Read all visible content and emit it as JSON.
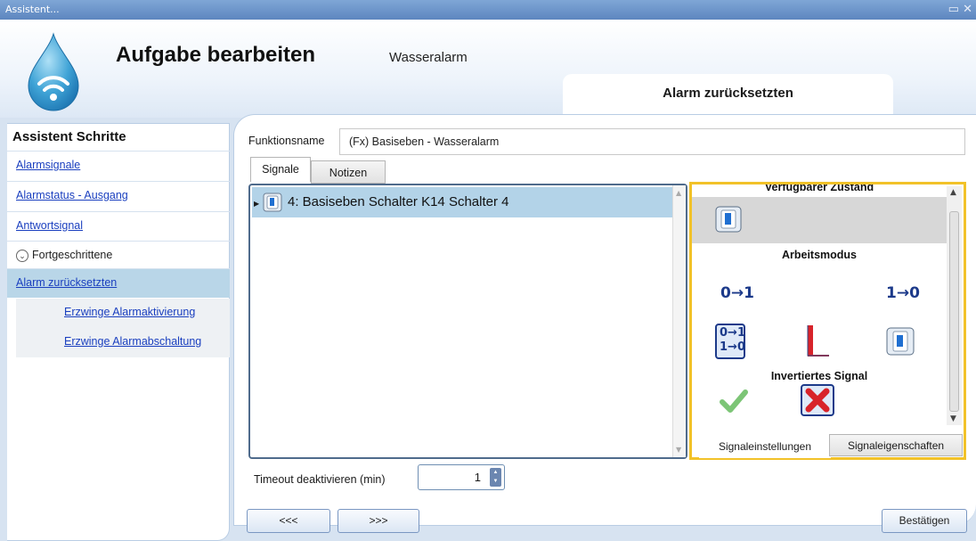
{
  "window": {
    "title": "Assistent..."
  },
  "header": {
    "title": "Aufgabe bearbeiten",
    "subtitle": "Wasseralarm",
    "step_tab": "Alarm zurücksetzten"
  },
  "sidebar": {
    "title": "Assistent Schritte",
    "items": [
      {
        "label": "Alarmsignale"
      },
      {
        "label": "Alarmstatus - Ausgang"
      },
      {
        "label": "Antwortsignal"
      },
      {
        "label": "Fortgeschrittene"
      },
      {
        "label": "Alarm zurücksetzten"
      },
      {
        "label": "Erzwinge Alarmaktivierung"
      },
      {
        "label": "Erzwinge Alarmabschaltung"
      }
    ]
  },
  "form": {
    "function_label": "Funktionsname",
    "function_value": "(Fx) Basiseben - Wasseralarm",
    "tabs": [
      "Signale",
      "Notizen"
    ],
    "signals": [
      {
        "label": "4: Basiseben Schalter K14 Schalter 4"
      }
    ],
    "timeout_label": "Timeout deaktivieren (min)",
    "timeout_value": "1"
  },
  "properties": {
    "sections": {
      "state": "Verfügbarer Zustand",
      "mode": "Arbeitsmodus",
      "inverted": "Invertiertes Signal"
    },
    "mode_labels": {
      "rising": "0→1",
      "falling": "1→0",
      "both_top": "0→1",
      "both_bottom": "1→0"
    },
    "tabs": [
      "Signaleinstellungen",
      "Signaleigenschaften"
    ]
  },
  "footer": {
    "back": "<<<",
    "next": ">>>",
    "confirm": "Bestätigen"
  },
  "colors": {
    "highlight": "#f2c229",
    "selection": "#b3d3e8",
    "link": "#1a3fbf"
  }
}
